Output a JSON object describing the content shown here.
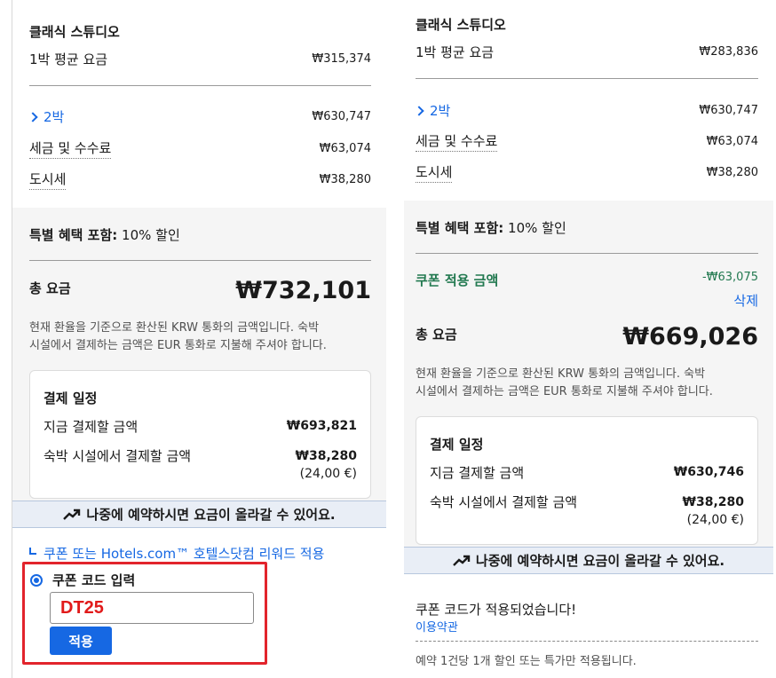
{
  "left": {
    "room_name": "클래식 스튜디오",
    "avg_rate_label": "1박 평균 요금",
    "avg_rate_value": "₩315,374",
    "nights_label": "2박",
    "nights_value": "₩630,747",
    "tax_label": "세금 및 수수료",
    "tax_value": "₩63,074",
    "city_tax_label": "도시세",
    "city_tax_value": "₩38,280",
    "special_label": "특별 혜택 포함:",
    "special_value": "10% 할인",
    "total_label": "총 요금",
    "total_value": "₩732,101",
    "currency_note_1": "현재 환율을 기준으로 환산된 KRW 통화의 금액입니다. 숙박",
    "currency_note_2": "시설에서 결제하는 금액은 EUR 통화로 지불해 주셔야 합니다.",
    "schedule_title": "결제 일정",
    "pay_now_label": "지금 결제할 금액",
    "pay_now_value": "₩693,821",
    "pay_property_label": "숙박 시설에서 결제할 금액",
    "pay_property_value": "₩38,280",
    "pay_property_eur": "(24,00 €)",
    "banner_text": "나중에 예약하시면 요금이 올라갈 수 있어요.",
    "coupon_link": "쿠폰 또는 Hotels.com™ 호텔스닷컴 리워드 적용",
    "coupon_radio_label": "쿠폰 코드 입력",
    "coupon_code_value": "DT25",
    "apply_button": "적용"
  },
  "right": {
    "room_name": "클래식 스튜디오",
    "avg_rate_label": "1박 평균 요금",
    "avg_rate_value": "₩283,836",
    "nights_label": "2박",
    "nights_value": "₩630,747",
    "tax_label": "세금 및 수수료",
    "tax_value": "₩63,074",
    "city_tax_label": "도시세",
    "city_tax_value": "₩38,280",
    "special_label": "특별 혜택 포함:",
    "special_value": "10% 할인",
    "coupon_applied_label": "쿠폰 적용 금액",
    "coupon_applied_value": "-₩63,075",
    "remove_link": "삭제",
    "total_label": "총 요금",
    "total_value": "₩669,026",
    "currency_note_1": "현재 환율을 기준으로 환산된 KRW 통화의 금액입니다. 숙박",
    "currency_note_2": "시설에서 결제하는 금액은 EUR 통화로 지불해 주셔야 합니다.",
    "schedule_title": "결제 일정",
    "pay_now_label": "지금 결제할 금액",
    "pay_now_value": "₩630,746",
    "pay_property_label": "숙박 시설에서 결제할 금액",
    "pay_property_value": "₩38,280",
    "pay_property_eur": "(24,00 €)",
    "banner_text": "나중에 예약하시면 요금이 올라갈 수 있어요.",
    "coupon_success": "쿠폰 코드가 적용되었습니다!",
    "terms_link": "이용약관",
    "footnote": "예약 1건당 1개 할인 또는 특가만 적용됩니다."
  },
  "colors": {
    "link_blue": "#1668e3",
    "discount_green": "#227950",
    "highlight_red": "#e2242c",
    "coupon_text_red": "#e11a1a"
  },
  "icons": [
    "chevron-right-icon",
    "trending-up-icon",
    "corner-arrow-icon",
    "radio-selected-icon"
  ]
}
